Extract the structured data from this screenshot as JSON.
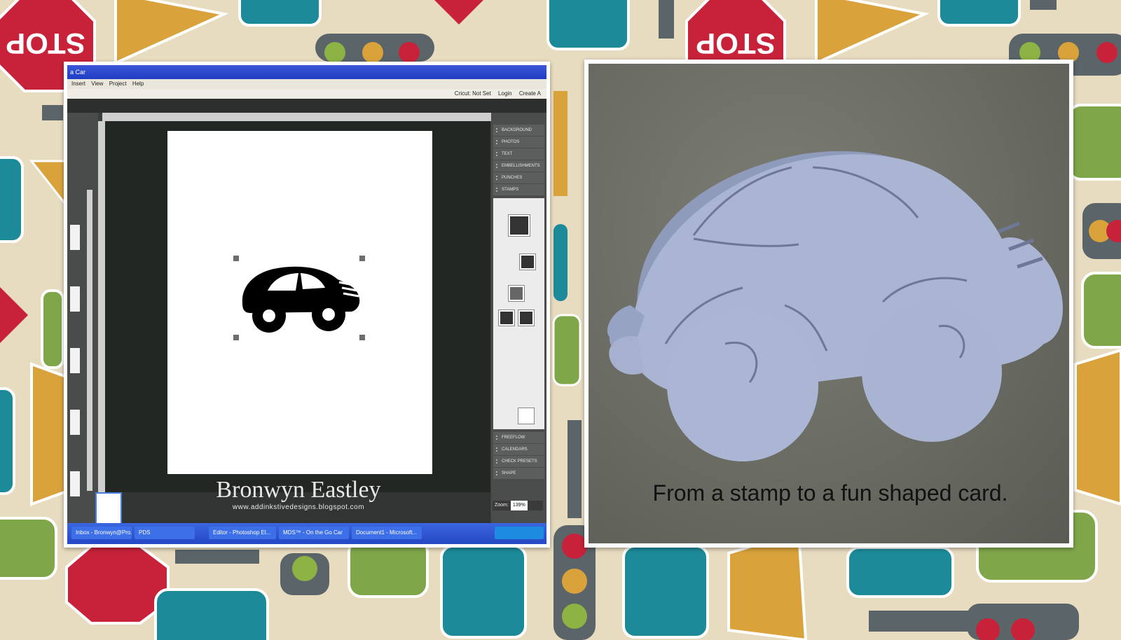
{
  "app": {
    "title": "a Car",
    "menu": [
      "Insert",
      "View",
      "Project",
      "Help"
    ],
    "status_items": [
      "Cricut: Not Set",
      "Login",
      "Create A"
    ],
    "panel_items": [
      "BACKGROUND",
      "PHOTOS",
      "TEXT",
      "EMBELLISHMENTS",
      "PUNCHES",
      "STAMPS"
    ],
    "panel_items_lower": [
      "FREEFLOW",
      "CALENDARS",
      "CHECK PRESETS",
      "SHAPE"
    ],
    "zoom_label": "Zoom:",
    "zoom_value": "139%",
    "taskbar_items": [
      "Inbox - Bronwyn@Pro...",
      "PDS",
      "Editor - Photoshop El...",
      "MDS™ - On the Go Car",
      "Document1 - Microsoft..."
    ]
  },
  "watermark": {
    "name": "Bronwyn Eastley",
    "url": "www.addinkstivedesigns.blogspot.com"
  },
  "caption": "From a stamp to a fun shaped card.",
  "colors": {
    "card": "#a9b5d3",
    "background_fabric": "#6b6c64",
    "page_bg": "#e8dcc0"
  }
}
